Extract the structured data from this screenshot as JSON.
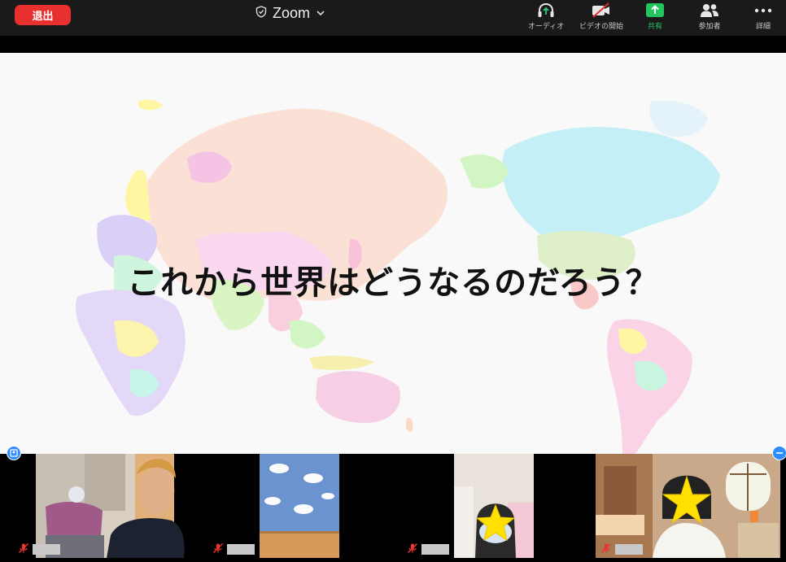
{
  "toolbar": {
    "leave_label": "退出",
    "title": "Zoom",
    "items": [
      {
        "label": "オーディオ",
        "icon": "headphones-icon"
      },
      {
        "label": "ビデオの開始",
        "icon": "video-off-icon"
      },
      {
        "label": "共有",
        "icon": "share-screen-icon"
      },
      {
        "label": "参加者",
        "icon": "participants-icon"
      },
      {
        "label": "詳細",
        "icon": "more-icon"
      }
    ],
    "share_color": "#22c55e",
    "leave_color": "#e8312e"
  },
  "slide": {
    "text": "これから世界はどうなるのだろう？",
    "background": "world-map-illustration"
  },
  "participants": [
    {
      "mic": "muted",
      "name_hidden": true
    },
    {
      "mic": "muted",
      "name_hidden": true
    },
    {
      "mic": "muted",
      "name_hidden": true
    },
    {
      "mic": "muted",
      "name_hidden": true
    }
  ]
}
